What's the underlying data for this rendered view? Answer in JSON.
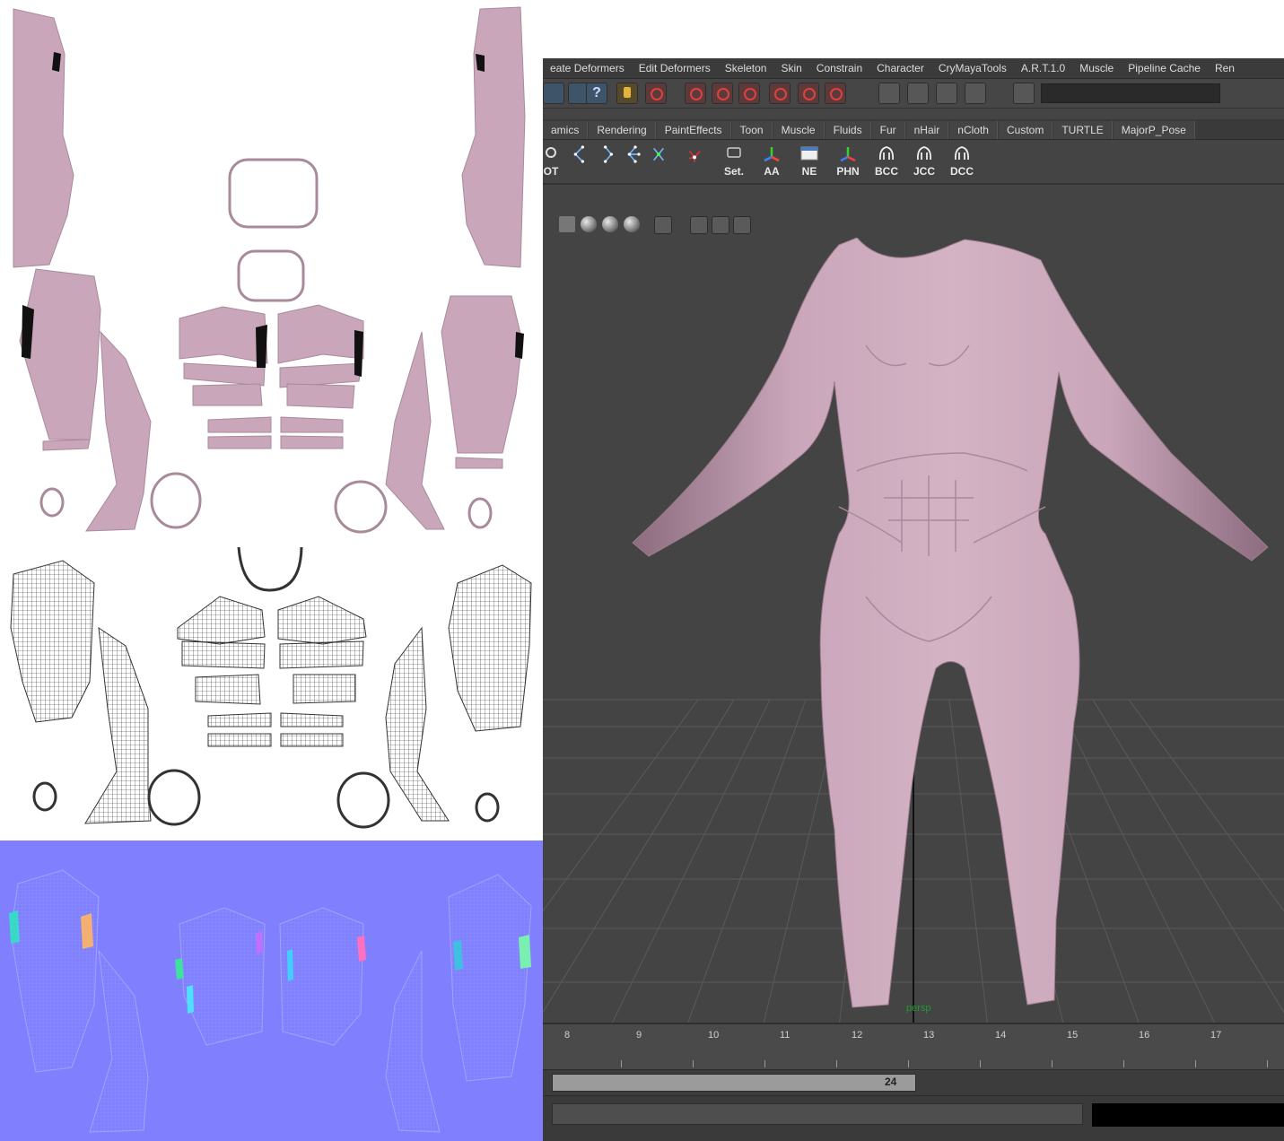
{
  "maya": {
    "menu": [
      "eate Deformers",
      "Edit Deformers",
      "Skeleton",
      "Skin",
      "Constrain",
      "Character",
      "CryMayaTools",
      "A.R.T.1.0",
      "Muscle",
      "Pipeline Cache",
      "Ren"
    ],
    "shelf_tabs": [
      "amics",
      "Rendering",
      "PaintEffects",
      "Toon",
      "Muscle",
      "Fluids",
      "Fur",
      "nHair",
      "nCloth",
      "Custom",
      "TURTLE",
      "MajorP_Pose"
    ],
    "shelf_buttons": [
      {
        "label": "OT",
        "icon": "joint-tool-icon"
      },
      {
        "label": "",
        "icon": "ik-chain-icon"
      },
      {
        "label": "",
        "icon": "bracket-chain-icon"
      },
      {
        "label": "",
        "icon": "joint-network-icon"
      },
      {
        "label": "",
        "icon": "locator-icon"
      },
      {
        "label": "Set.",
        "icon": "set-icon"
      },
      {
        "label": "AA",
        "icon": "axis-icon"
      },
      {
        "label": "NE",
        "icon": "window-icon"
      },
      {
        "label": "PHN",
        "icon": "axis-icon"
      },
      {
        "label": "BCC",
        "icon": "crysis-icon"
      },
      {
        "label": "JCC",
        "icon": "crysis-icon"
      },
      {
        "label": "DCC",
        "icon": "crysis-icon"
      }
    ],
    "help_label": "?",
    "camera_label": "persp",
    "timeline_ticks": [
      "8",
      "9",
      "10",
      "11",
      "12",
      "13",
      "14",
      "15",
      "16",
      "17"
    ],
    "range_end": "24",
    "colors": {
      "mesh": "#c9a6b9",
      "viewport_bg": "#444444",
      "grid": "#5a5a5a",
      "normal_map": "#8080fe"
    }
  },
  "uv_panel": {
    "sections": [
      "uv-layout-solid",
      "uv-layout-wireframe",
      "normal-map"
    ]
  }
}
